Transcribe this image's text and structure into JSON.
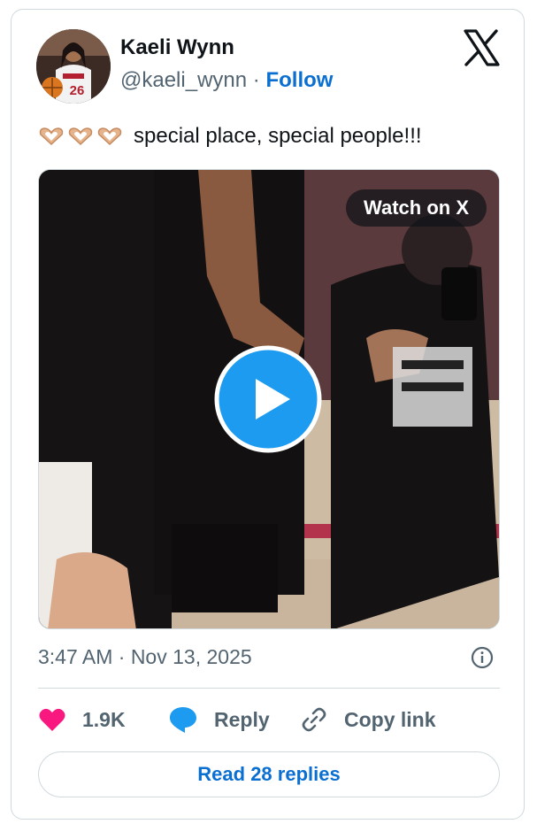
{
  "author": {
    "name": "Kaeli Wynn",
    "handle": "@kaeli_wynn",
    "separator": "·",
    "follow_label": "Follow",
    "avatar_jersey_number": "26"
  },
  "tweet": {
    "emoji": "🫶🫶🫶",
    "text": "special place, special people!!!"
  },
  "media": {
    "watch_label": "Watch on X",
    "play_icon": "play-icon"
  },
  "meta": {
    "timestamp": "3:47 AM · Nov 13, 2025",
    "info_icon": "info-icon"
  },
  "actions": {
    "like_count": "1.9K",
    "reply_label": "Reply",
    "copy_label": "Copy link"
  },
  "footer": {
    "read_replies_label": "Read 28 replies"
  },
  "colors": {
    "accent": "#1d9bf0",
    "link": "#0b6fd1",
    "like": "#f91880",
    "muted": "#536471",
    "border": "#cfd9de"
  }
}
